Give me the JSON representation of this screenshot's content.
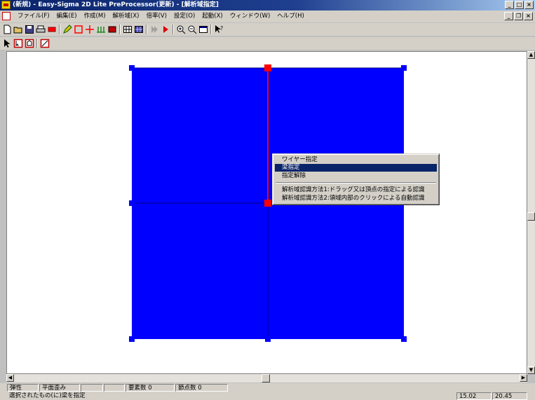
{
  "window": {
    "title": "(新規) - Easy-Sigma 2D Lite PreProcessor(更新) - [解析域指定]",
    "min_glyph": "_",
    "max_glyph": "□",
    "close_glyph": "×",
    "restore_glyph": "❐"
  },
  "menu": {
    "items": [
      "ファイル(F)",
      "編集(E)",
      "作成(M)",
      "解析域(X)",
      "倍率(V)",
      "設定(O)",
      "起動(X)",
      "ウィンドウ(W)",
      "ヘルプ(H)"
    ]
  },
  "toolbar1": {
    "icons": [
      "new-icon",
      "open-icon",
      "save-icon",
      "print-icon",
      "rect-icon",
      "pencil-icon",
      "select-rect-icon",
      "node-icon",
      "support-icon",
      "load-icon",
      "grid-icon",
      "mesh-icon",
      "play-icon",
      "run-icon",
      "zoom-in-icon",
      "zoom-out-icon",
      "fit-icon",
      "help-cursor-icon"
    ]
  },
  "toolbar2": {
    "icons": [
      "arrow-cursor-icon",
      "region-select-icon",
      "region-auto-icon",
      "region-clear-icon"
    ]
  },
  "model": {
    "fill_color": "#0000ff",
    "highlight_color": "#ff0000"
  },
  "context_menu": {
    "items": [
      {
        "label": "ワイヤー指定",
        "selected": false
      },
      {
        "label": "梁指定",
        "selected": true
      },
      {
        "label": "指定解除",
        "selected": false
      },
      {
        "label": "解析域認識方法1:ドラッグ又は頂点の指定による認識",
        "selected": false
      },
      {
        "label": "解析域認識方法2:領域内部のクリックによる自動認識",
        "selected": false
      }
    ]
  },
  "status": {
    "cells": [
      "弾性",
      "平面歪み",
      "",
      "",
      "要素数 0",
      "節点数 0"
    ],
    "message": "選択されたもの(に)梁を指定",
    "coord_x": "15.02",
    "coord_y": "20.45"
  }
}
